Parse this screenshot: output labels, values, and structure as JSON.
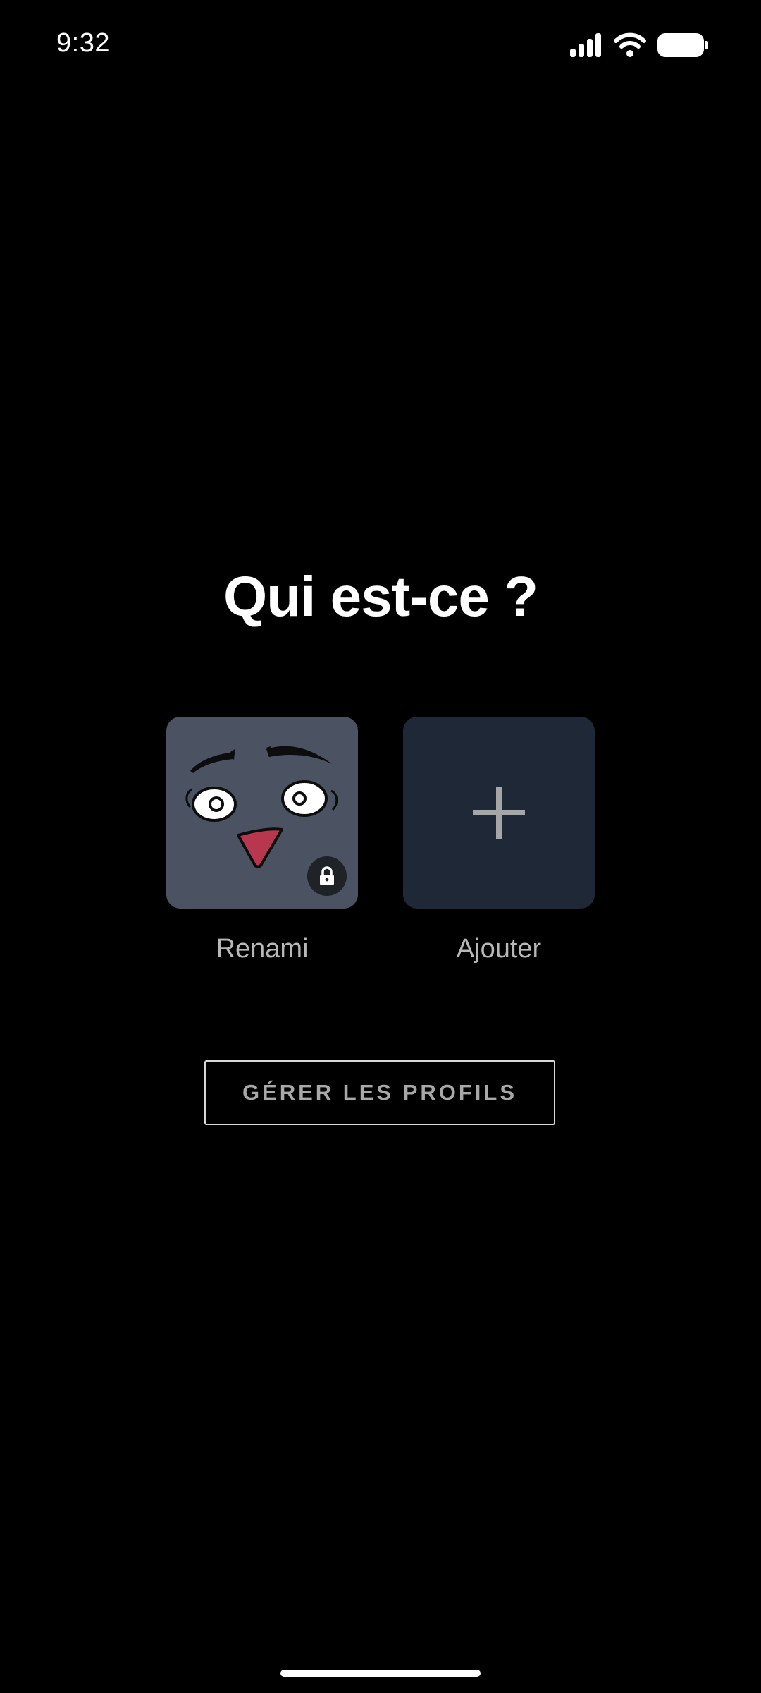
{
  "status_bar": {
    "time": "9:32",
    "icons": [
      "signal-icon",
      "wifi-icon",
      "battery-icon"
    ]
  },
  "title": "Qui est-ce ?",
  "profiles": [
    {
      "name": "Renami",
      "avatar": "face-avatar",
      "locked": true,
      "icon": "lock-icon",
      "tile_color": "#4b5363"
    },
    {
      "name": "Ajouter",
      "icon": "plus-icon",
      "tile_color": "#1e2836"
    }
  ],
  "manage_button": {
    "label": "GÉRER LES PROFILS"
  },
  "colors": {
    "background": "#000000",
    "text_primary": "#ffffff",
    "text_secondary": "#b8b8b8",
    "tongue": "#b7374f"
  }
}
